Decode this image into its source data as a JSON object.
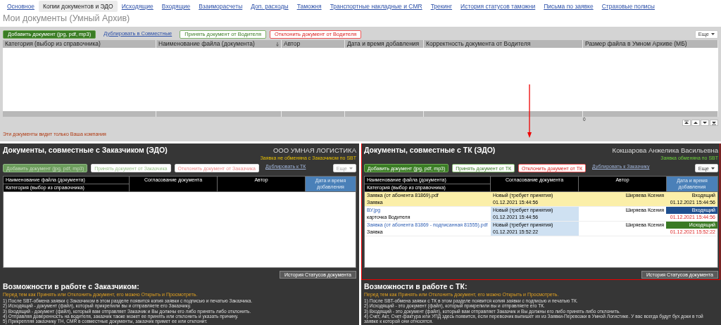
{
  "nav_tabs": [
    {
      "label": "Основное",
      "selected": false
    },
    {
      "label": "Копии документов и ЭДО",
      "selected": true
    },
    {
      "label": "Исходящие",
      "selected": false
    },
    {
      "label": "Входящие",
      "selected": false
    },
    {
      "label": "Взаиморасчеты",
      "selected": false
    },
    {
      "label": "Доп. расходы",
      "selected": false
    },
    {
      "label": "Таможня",
      "selected": false
    },
    {
      "label": "Транспортные накладные и CMR",
      "selected": false
    },
    {
      "label": "Трекинг",
      "selected": false
    },
    {
      "label": "История статусов таможни",
      "selected": false
    },
    {
      "label": "Письма по заявке",
      "selected": false
    },
    {
      "label": "Страховые полисы",
      "selected": false
    }
  ],
  "archive": {
    "title": "Мои документы (Умный Архив)",
    "toolbar": [
      {
        "kind": "add",
        "label": "Добавить документ (jpg, pdf, mp3)",
        "disabled": false
      },
      {
        "kind": "link",
        "label": "Дублировать в Совместные",
        "disabled": false
      },
      {
        "kind": "accept",
        "label": "Принять документ от Водителя",
        "disabled": false
      },
      {
        "kind": "reject",
        "label": "Отклонить документ от Водителя",
        "disabled": false
      }
    ],
    "more_button": {
      "label": "Еще",
      "disabled": false
    },
    "columns": [
      {
        "label": "Категория (выбор из справочника)",
        "sorted": false
      },
      {
        "label": "Наименование файла (документа)",
        "sorted": true
      },
      {
        "label": "Автор",
        "sorted": false
      },
      {
        "label": "Дата и время добавления",
        "sorted": false
      },
      {
        "label": "Корректность документа от Водителя",
        "sorted": false
      },
      {
        "label": "Размер файла в Умном Архиве (МБ)",
        "sorted": false
      }
    ],
    "footer_total": "0",
    "note": "Эти документы видит только Ваша компания"
  },
  "panels": [
    {
      "title": "Документы, совместные с Заказчиком (ЭДО)",
      "counterparty": "ООО УМНАЯ ЛОГИСТИКА",
      "highlighted": false,
      "sbt_status": {
        "text": "Заявка не обменяна с Заказчиком по SBT",
        "exchanged": false
      },
      "toolbar": [
        {
          "kind": "add",
          "label": "Добавить документ (jpg, pdf, mp3)",
          "disabled": true
        },
        {
          "kind": "accept",
          "label": "Принять документ от Заказчика",
          "disabled": true
        },
        {
          "kind": "reject",
          "label": "Отклонить документ от Заказчика",
          "disabled": true
        },
        {
          "kind": "link",
          "label": "Дублировать к ТК",
          "disabled": false
        }
      ],
      "more_button": {
        "label": "Еще",
        "disabled": true
      },
      "columns": {
        "file_name": "Наименование файла (документа)",
        "category": "Категория (выбор из справочника)",
        "approval": "Согласование документа",
        "author": "Автор",
        "date_added": "Дата и время добавления"
      },
      "history_button": "История Статусов документа",
      "info": {
        "heading": "Возможности в работе с Заказчиком:",
        "hint": "Перед тем как Принять или Отклонить документ, его можно Открыть и Просмотреть.",
        "items": [
          "1) После SBT-обмена заявки с Заказчиком в этом разделе появится копия заявки с подписью и печатью Заказчика.",
          "2) Исходящий - документ (файл), который прикрепили вы и отправляете его Заказчику.",
          "3) Входящий - документ (файл), который вам отправляет Заказчик и Вы должны его либо принять либо отклонить.",
          "4) Отправляя доверенность на водителя, заказчик также может ее принять или отклонить и указать причину.",
          "5) Прикрепляя заказчику ТН, CMR в совместные документы, заказчик примет ее или отклонит."
        ]
      }
    },
    {
      "title": "Документы, совместные с ТК (ЭДО)",
      "counterparty": "Кокшарова Анжелика Васильевна",
      "highlighted": true,
      "sbt_status": {
        "text": "Заявка обменяна по SBT",
        "exchanged": true
      },
      "toolbar": [
        {
          "kind": "add",
          "label": "Добавить документ (jpg, pdf, mp3)",
          "disabled": false
        },
        {
          "kind": "accept",
          "label": "Принять документ от ТК",
          "disabled": false
        },
        {
          "kind": "reject",
          "label": "Отклонить документ от ТК",
          "disabled": false
        },
        {
          "kind": "link",
          "label": "Дублировать к Заказчику",
          "disabled": false
        }
      ],
      "more_button": {
        "label": "Еще",
        "disabled": false
      },
      "columns": {
        "file_name": "Наименование файла (документа)",
        "category": "Категория (выбор из справочника)",
        "approval": "Согласование документа",
        "author": "Автор",
        "date_added": "Дата и время добавления"
      },
      "rows": [
        {
          "selected": true,
          "file_name": "Заявка (от абонента 81869).pdf",
          "category": "Заявка",
          "status": "Новый (требует принятия)",
          "status_date": "01.12.2021 15:44:56",
          "author": "Ширяева Ксения",
          "direction": {
            "kind": "incoming",
            "label": "Входящий"
          },
          "date": "01.12.2021 15:44:56"
        },
        {
          "selected": false,
          "file_name": "ВУ.jpg",
          "category": "карточка Водителя",
          "status": "Новый (требует принятия)",
          "status_date": "01.12.2021 15:44:56",
          "author": "Ширяева Ксения",
          "direction": {
            "kind": "incoming",
            "label": "Входящий"
          },
          "date": "01.12.2021 15:44:56"
        },
        {
          "selected": false,
          "file_name": "Заявка (от абонента 81869 - подписанная 81555).pdf",
          "category": "Заявка",
          "status": "Новый (требует принятия)",
          "status_date": "01.12.2021 15:52:22",
          "author": "Ширяева Ксения",
          "direction": {
            "kind": "outgoing",
            "label": "Исходящий"
          },
          "date": "01.12.2021 15:52:22"
        }
      ],
      "history_button": "История Статусов документа",
      "info": {
        "heading": "Возможности в работе с ТК:",
        "hint": "Перед тем как Принять или Отклонить документ, его можно Открыть и Просмотреть.",
        "items": [
          "1) После SBT-обмена заявки с ТК в этом разделе появится копия заявки с подписью и печатью ТК.",
          "2) Исходящий - это документ (файл), который прикрепили вы и отправляете его ТК.",
          "3) Входящий - это документ (файл), который вам отправляет Заказчик и Вы должны его либо принять либо отклонить.",
          "4) Счет, Акт, Счет-фактура или УПД здесь появится, если перевозчик выпишет их из Заявки-Перевозки в Умной Логистике. У вас всегда будут бух доки в той заявке к которой они относятся."
        ]
      }
    }
  ]
}
